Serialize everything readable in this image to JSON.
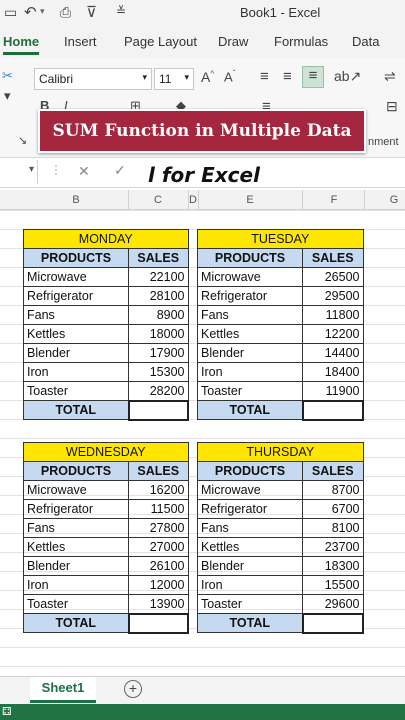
{
  "titlebar": {
    "title": "Book1 - Excel"
  },
  "ribbon_tabs": [
    "Home",
    "Insert",
    "Page Layout",
    "Draw",
    "Formulas",
    "Data"
  ],
  "ribbon": {
    "font_name": "Calibri",
    "font_size": "11",
    "partial_label": "nment"
  },
  "banner": {
    "text": "SUM Function in Multiple Data"
  },
  "subtitle": {
    "text": "l for Excel"
  },
  "columns": [
    "B",
    "C",
    "D",
    "E",
    "F",
    "G"
  ],
  "tables": [
    {
      "day": "MONDAY",
      "headers": [
        "PRODUCTS",
        "SALES"
      ],
      "rows": [
        [
          "Microwave",
          "22100"
        ],
        [
          "Refrigerator",
          "28100"
        ],
        [
          "Fans",
          "8900"
        ],
        [
          "Kettles",
          "18000"
        ],
        [
          "Blender",
          "17900"
        ],
        [
          "Iron",
          "15300"
        ],
        [
          "Toaster",
          "28200"
        ]
      ],
      "total_label": "TOTAL"
    },
    {
      "day": "TUESDAY",
      "headers": [
        "PRODUCTS",
        "SALES"
      ],
      "rows": [
        [
          "Microwave",
          "26500"
        ],
        [
          "Refrigerator",
          "29500"
        ],
        [
          "Fans",
          "11800"
        ],
        [
          "Kettles",
          "12200"
        ],
        [
          "Blender",
          "14400"
        ],
        [
          "Iron",
          "18400"
        ],
        [
          "Toaster",
          "11900"
        ]
      ],
      "total_label": "TOTAL"
    },
    {
      "day": "WEDNESDAY",
      "headers": [
        "PRODUCTS",
        "SALES"
      ],
      "rows": [
        [
          "Microwave",
          "16200"
        ],
        [
          "Refrigerator",
          "11500"
        ],
        [
          "Fans",
          "27800"
        ],
        [
          "Kettles",
          "27000"
        ],
        [
          "Blender",
          "26100"
        ],
        [
          "Iron",
          "12000"
        ],
        [
          "Toaster",
          "13900"
        ]
      ],
      "total_label": "TOTAL"
    },
    {
      "day": "THURSDAY",
      "headers": [
        "PRODUCTS",
        "SALES"
      ],
      "rows": [
        [
          "Microwave",
          "8700"
        ],
        [
          "Refrigerator",
          "6700"
        ],
        [
          "Fans",
          "8100"
        ],
        [
          "Kettles",
          "23700"
        ],
        [
          "Blender",
          "18300"
        ],
        [
          "Iron",
          "15500"
        ],
        [
          "Toaster",
          "29600"
        ]
      ],
      "total_label": "TOTAL"
    }
  ],
  "sheet": {
    "name": "Sheet1"
  },
  "colors": {
    "excel_green": "#217346",
    "header_yellow": "#ffe600",
    "header_blue": "#c5d9f1",
    "banner_red": "#a5263f"
  }
}
